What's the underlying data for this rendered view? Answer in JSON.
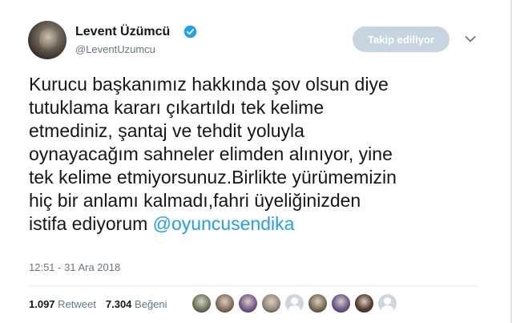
{
  "author": {
    "name": "Levent Üzümcü",
    "handle": "@LeventUzumcu",
    "verified": true
  },
  "follow_button": {
    "label": "Takip ediliyor"
  },
  "tweet": {
    "text": "Kurucu başkanımız hakkında şov olsun diye\ntutuklama kararı çıkartıldı tek kelime\netmediniz, şantaj ve tehdit yoluyla\noynayacağım sahneler elimden alınıyor, yine\ntek kelime etmiyorsunuz.Birlikte yürümemizin\nhiç bir anlamı kalmadı,fahri üyeliğinizden\nistifa ediyorum ",
    "mention": "@oyuncusendika",
    "timestamp": "12:51 - 31 Ara 2018"
  },
  "stats": {
    "retweet_count": "1.097",
    "retweet_label": "Retweet",
    "like_count": "7.304",
    "like_label": "Beğeni"
  },
  "likers": [
    {
      "name": "liker-1",
      "color": "#6b7a5a"
    },
    {
      "name": "liker-2",
      "color": "#8a6f5c"
    },
    {
      "name": "liker-3",
      "color": "#7a5b8c"
    },
    {
      "name": "liker-4",
      "color": "#9a8a7a"
    },
    {
      "name": "liker-5",
      "color": "default"
    },
    {
      "name": "liker-6",
      "color": "#7d6a55"
    },
    {
      "name": "liker-7",
      "color": "#6a5a8f"
    },
    {
      "name": "liker-8",
      "color": "#5a3a2e"
    },
    {
      "name": "liker-9",
      "color": "default"
    }
  ],
  "colors": {
    "accent": "#1da1f2",
    "muted_text": "#657786",
    "follow_button_bg": "#c8d5e1"
  }
}
